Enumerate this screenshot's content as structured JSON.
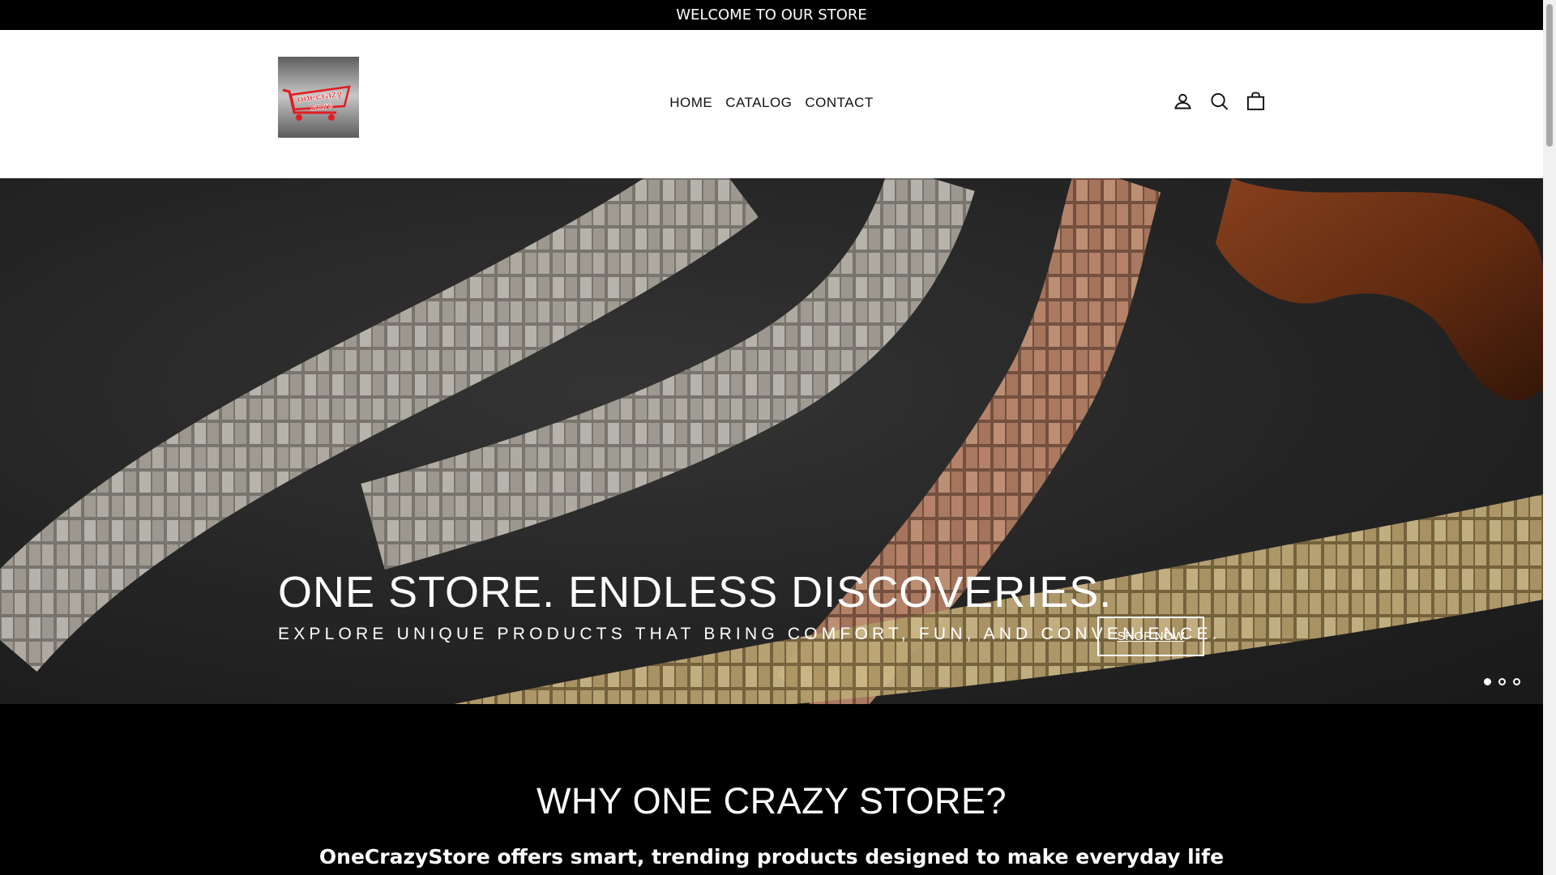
{
  "announcement": "WELCOME TO OUR STORE",
  "logo": {
    "line1": "onecrazy",
    "line2": "Store"
  },
  "nav": {
    "items": [
      "HOME",
      "CATALOG",
      "CONTACT"
    ]
  },
  "icons": {
    "account": "user-icon",
    "search": "search-icon",
    "cart": "bag-icon"
  },
  "hero": {
    "title": "ONE STORE. ENDLESS DISCOVERIES.",
    "subtitle": "EXPLORE UNIQUE PRODUCTS THAT BRING COMFORT, FUN, AND CONVENIENCE.",
    "button": "SHOP NOW",
    "slides": 3,
    "active_slide": 1
  },
  "why": {
    "heading": "WHY ONE CRAZY STORE?",
    "text": "OneCrazyStore offers smart, trending products designed to make everyday life"
  },
  "colors": {
    "accent": "#e21b23",
    "text": "#111111"
  }
}
